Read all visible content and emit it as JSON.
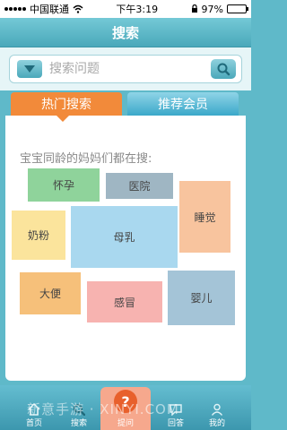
{
  "status": {
    "carrier": "中国联通",
    "time": "下午3:19",
    "battery": "97%",
    "battery_level": 0.97
  },
  "header": {
    "title": "搜索"
  },
  "search": {
    "placeholder": "搜索问题"
  },
  "tabs": [
    {
      "label": "热门搜索",
      "active": true
    },
    {
      "label": "推荐会员",
      "active": false
    }
  ],
  "panel": {
    "subtitle": "宝宝同龄的妈妈们都在搜:",
    "tags": [
      {
        "label": "怀孕",
        "color": "#8fd39b"
      },
      {
        "label": "医院",
        "color": "#9fb6c3"
      },
      {
        "label": "睡觉",
        "color": "#f8c49e"
      },
      {
        "label": "奶粉",
        "color": "#fbe49c"
      },
      {
        "label": "母乳",
        "color": "#a9d8ef"
      },
      {
        "label": "大便",
        "color": "#f6c07a"
      },
      {
        "label": "感冒",
        "color": "#f7b3b0"
      },
      {
        "label": "婴儿",
        "color": "#a4c4d7"
      }
    ]
  },
  "nav": {
    "items": [
      {
        "label": "首页",
        "icon": "home-icon"
      },
      {
        "label": "搜索",
        "icon": "search-icon"
      },
      {
        "label": "提问",
        "icon": "question-icon"
      },
      {
        "label": "回答",
        "icon": "answer-icon"
      },
      {
        "label": "我的",
        "icon": "user-icon"
      }
    ],
    "active_badge": "?"
  },
  "watermark": "新意手游 · XINYI.COM",
  "colors": {
    "accent": "#f28a3a",
    "header": "#4aa8ba",
    "active_nav": "#f6a88d"
  }
}
